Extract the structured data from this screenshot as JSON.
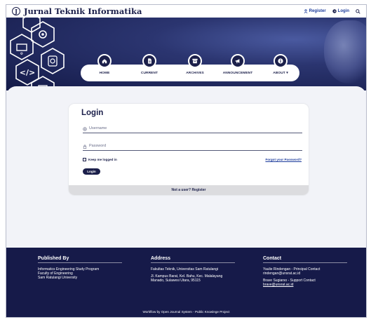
{
  "header": {
    "logo_glyph": "J",
    "title": "Jurnal Teknik Informatika",
    "register_label": "Register",
    "login_label": "Login"
  },
  "nav": {
    "items": [
      {
        "label": "HOME",
        "icon": "home-icon"
      },
      {
        "label": "CURRENT",
        "icon": "document-icon"
      },
      {
        "label": "ARCHIVES",
        "icon": "archive-icon"
      },
      {
        "label": "ANNOUNCEMENT",
        "icon": "megaphone-icon"
      },
      {
        "label": "ABOUT ▾",
        "icon": "info-icon"
      }
    ]
  },
  "login": {
    "title": "Login",
    "username_placeholder": "Username",
    "password_placeholder": "Password",
    "remember_label": "Keep me logged in",
    "forgot_label": "Forgot your Password?",
    "button_label": "Login",
    "register_prompt": "Not a user? Register"
  },
  "footer": {
    "published": {
      "heading": "Published By",
      "line1": "Informatics Engineering Study Program",
      "line2": "Faculty of Engineering",
      "line3": "Sam Ratulangi University"
    },
    "address": {
      "heading": "Address",
      "line1": "Fakultas Teknik, Universitas Sam Ratulangi",
      "line2": "Jl. Kampus Barat, Kel. Bahu, Kec. Malalayang",
      "line3": "Manado, Sulawesi Utara, 95115"
    },
    "contact": {
      "heading": "Contact",
      "principal": "Yaulie Rindengan - Principal Contact",
      "principal_email": "rindengan@unsrat.ac.id",
      "support": "Brave Sugiarso - Support Contact",
      "support_email": "brave@unsrat.ac.id"
    },
    "powered_by": "Workflow by Open Journal System - Public Knowlege Project"
  },
  "colors": {
    "navy": "#1b1f4a",
    "link_blue": "#1d3c9c",
    "footer_bg": "#161a49"
  }
}
